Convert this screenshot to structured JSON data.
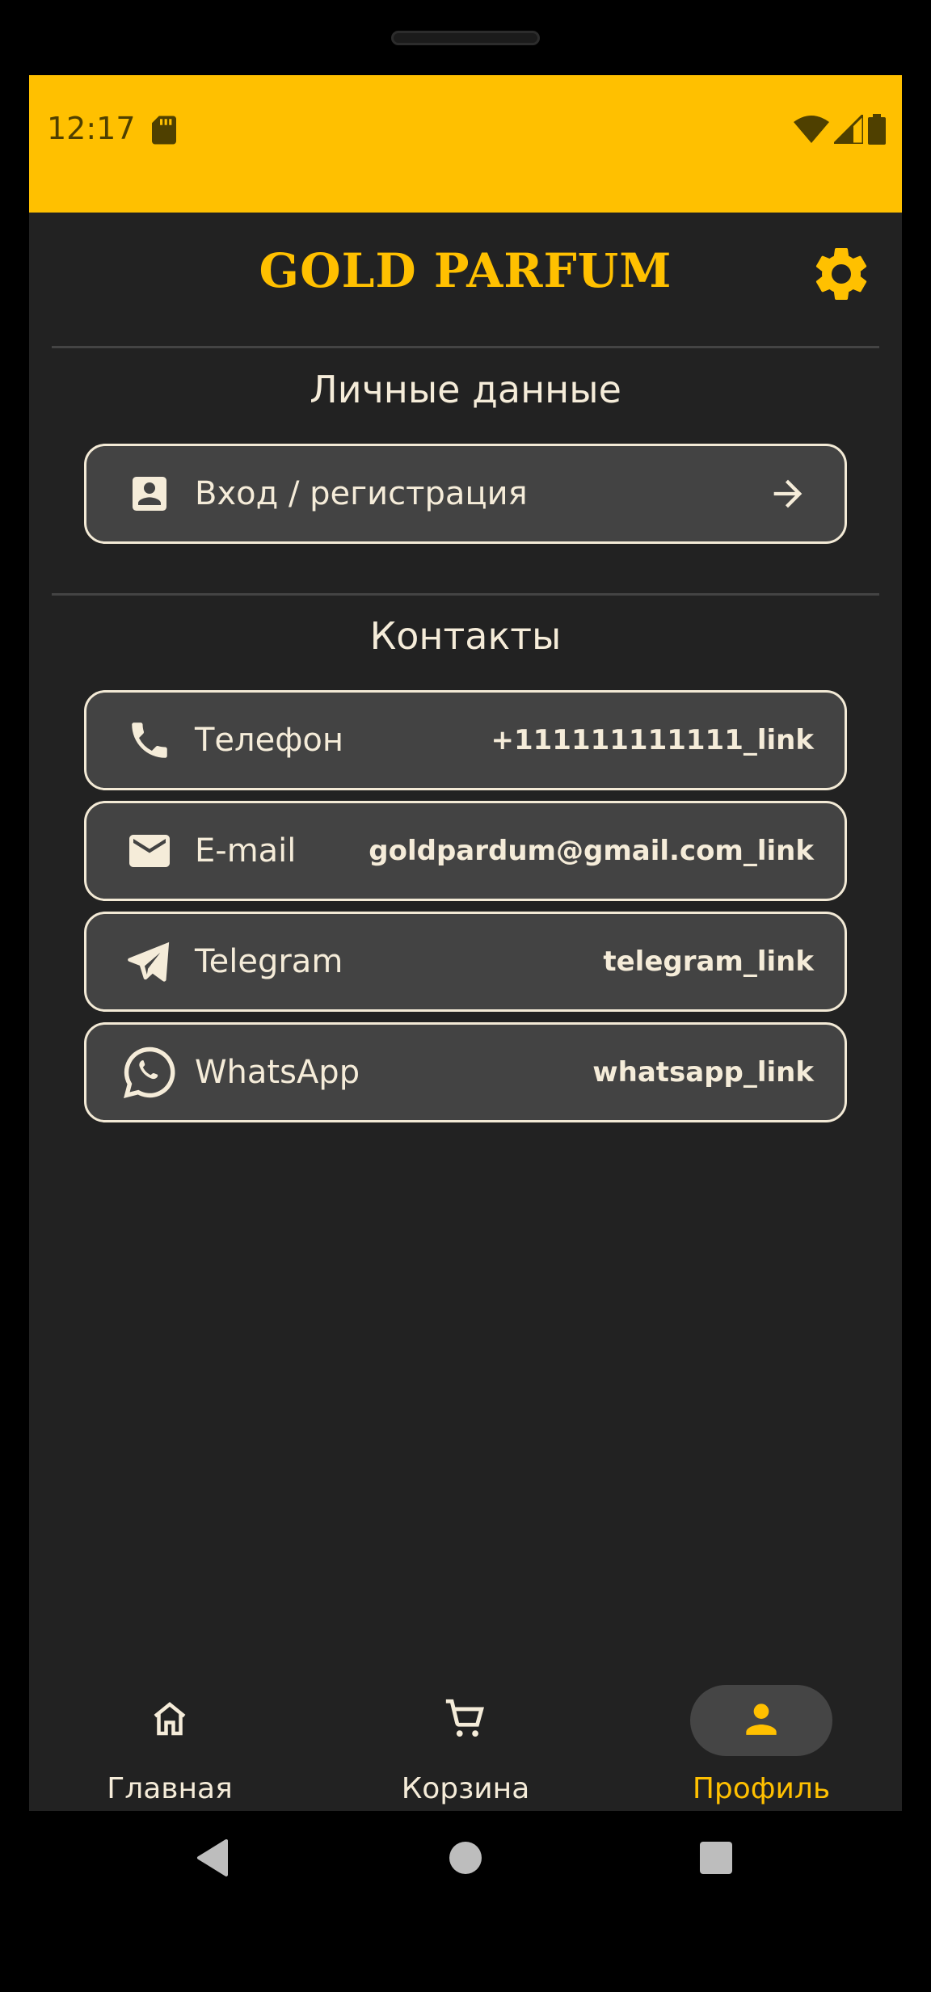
{
  "status_bar": {
    "time": "12:17",
    "icons": [
      "sd-card-icon",
      "wifi-icon",
      "signal-icon",
      "battery-icon"
    ]
  },
  "app_bar": {
    "title": "GOLD PARFUM",
    "settings_icon": "gear-icon"
  },
  "personal": {
    "section_title": "Личные данные",
    "login": {
      "icon": "account-box-icon",
      "label": "Вход / регистрация",
      "trailing_icon": "arrow-right-icon"
    }
  },
  "contacts": {
    "section_title": "Контакты",
    "items": [
      {
        "icon": "phone-icon",
        "label": "Телефон",
        "value": "+111111111111_link"
      },
      {
        "icon": "email-icon",
        "label": "E-mail",
        "value": "goldpardum@gmail.com_link"
      },
      {
        "icon": "telegram-icon",
        "label": "Telegram",
        "value": "telegram_link"
      },
      {
        "icon": "whatsapp-icon",
        "label": "WhatsApp",
        "value": "whatsapp_link"
      }
    ]
  },
  "bottom_nav": {
    "items": [
      {
        "icon": "home-icon",
        "label": "Главная",
        "active": false
      },
      {
        "icon": "cart-icon",
        "label": "Корзина",
        "active": false
      },
      {
        "icon": "person-icon",
        "label": "Профиль",
        "active": true
      }
    ]
  },
  "colors": {
    "accent": "#FFC000",
    "background": "#222222",
    "card": "#434343",
    "text": "#F5ECD9"
  }
}
